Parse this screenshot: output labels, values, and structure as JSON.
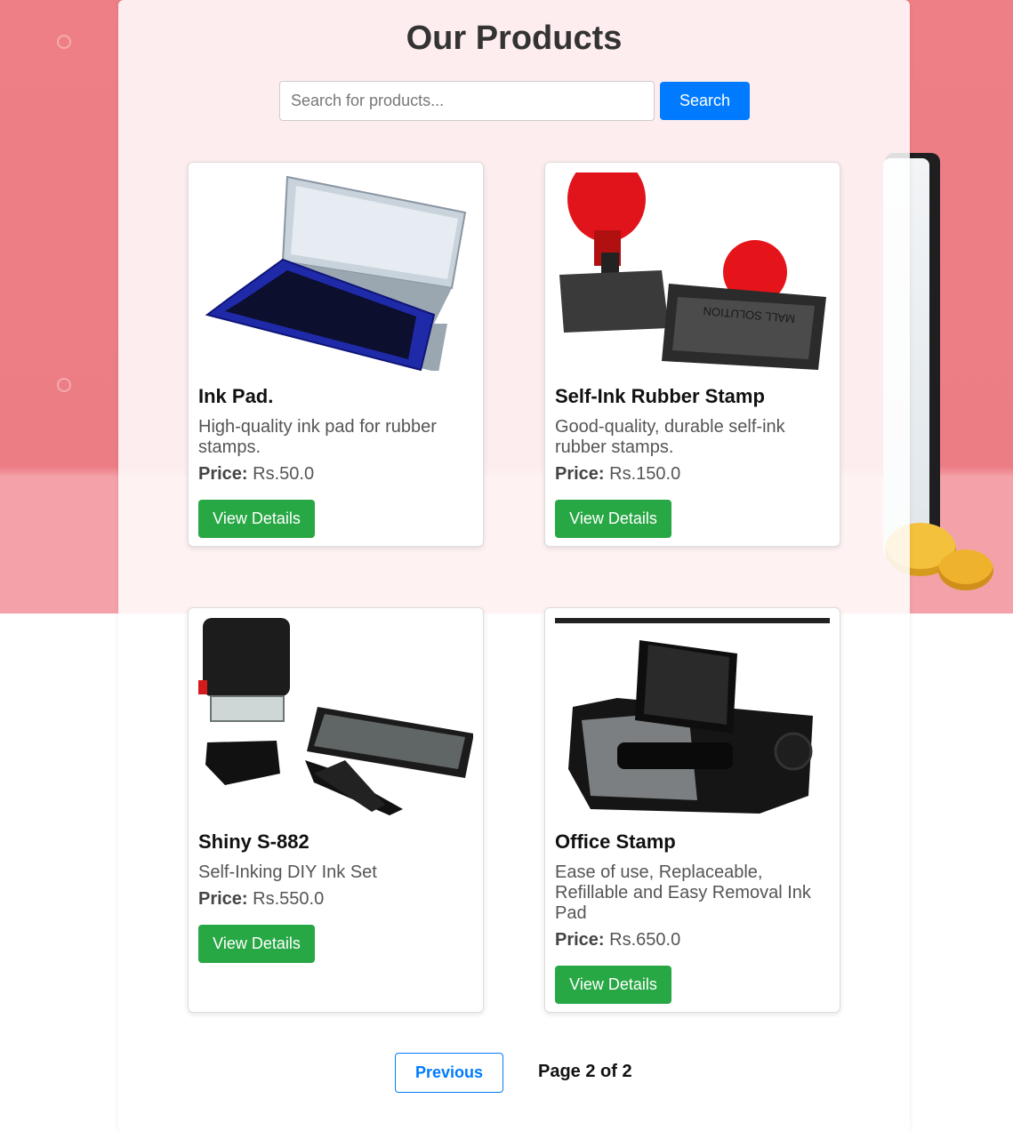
{
  "header": {
    "title": "Our Products"
  },
  "search": {
    "placeholder": "Search for products...",
    "button_label": "Search"
  },
  "products": [
    {
      "name": "Ink Pad.",
      "description": "High-quality ink pad for rubber stamps.",
      "price_label": "Price:",
      "price": "Rs.50.0",
      "button_label": "View Details",
      "image_icon": "ink-pad-image"
    },
    {
      "name": "Self-Ink Rubber Stamp",
      "description": "Good-quality, durable self-ink rubber stamps.",
      "price_label": "Price:",
      "price": "Rs.150.0",
      "button_label": "View Details",
      "image_icon": "rubber-stamp-image",
      "image_text": "MALL SOLUTION"
    },
    {
      "name": "Shiny S-882",
      "description": "Self-Inking DIY Ink Set",
      "price_label": "Price:",
      "price": "Rs.550.0",
      "button_label": "View Details",
      "image_icon": "diy-ink-set-image"
    },
    {
      "name": "Office Stamp",
      "description": "Ease of use, Replaceable, Refillable and Easy Removal Ink Pad",
      "price_label": "Price:",
      "price": "Rs.650.0",
      "button_label": "View Details",
      "image_icon": "office-stamp-image"
    }
  ],
  "pagination": {
    "previous_label": "Previous",
    "page_text": "Page 2 of 2"
  },
  "colors": {
    "primary": "#007bff",
    "success": "#28a745",
    "background_pink": "#ec7d85"
  }
}
